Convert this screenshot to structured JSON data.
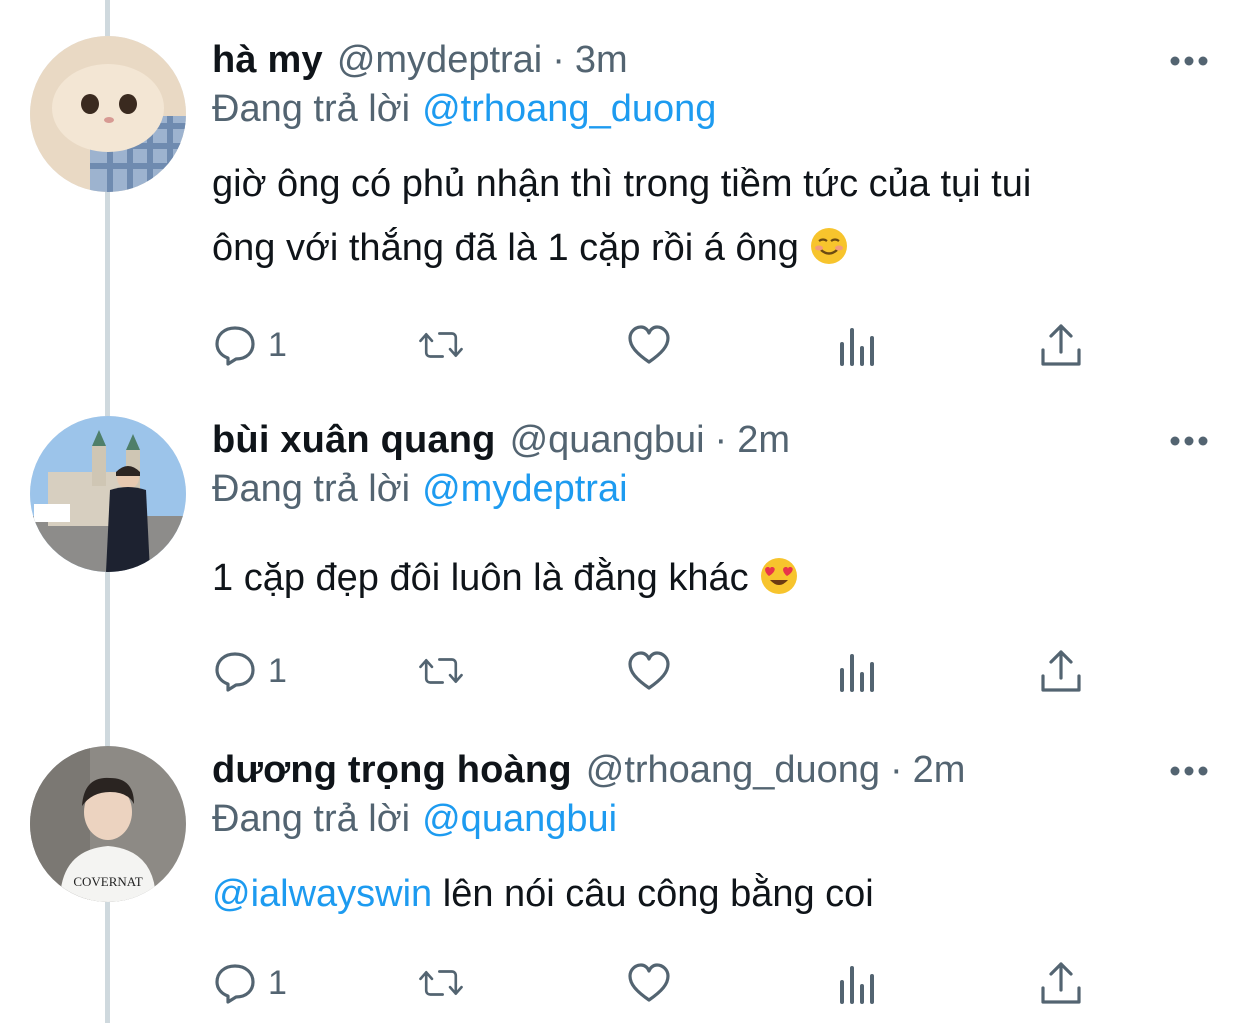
{
  "tweets": [
    {
      "name": "hà my",
      "handle": "@mydeptrai",
      "dot": "·",
      "time": "3m",
      "reply_prefix": "Đang trả lời",
      "reply_to": "@trhoang_duong",
      "text_line1": "giờ ông có phủ nhận thì trong tiềm tức của tụi tui",
      "text_line2": "ông với thắng đã là 1 cặp rồi á ông",
      "emoji": "☺️",
      "reply_count": "1"
    },
    {
      "name": "bùi xuân quang",
      "handle": "@quangbui",
      "dot": "·",
      "time": "2m",
      "reply_prefix": "Đang trả lời",
      "reply_to": "@mydeptrai",
      "text_line1": "1 cặp đẹp đôi luôn là đằng khác",
      "emoji": "😍",
      "reply_count": "1"
    },
    {
      "name": "dương trọng hoàng",
      "handle": "@trhoang_duong",
      "dot": "·",
      "time": "2m",
      "reply_prefix": "Đang trả lời",
      "reply_to": "@quangbui",
      "mention": "@ialwayswin",
      "text_rest": " lên nói câu công bằng coi",
      "reply_count": "1",
      "avatar_shirt_text": "COVERNAT"
    }
  ],
  "icons": [
    "reply-icon",
    "retweet-icon",
    "like-icon",
    "views-icon",
    "share-icon",
    "more-icon"
  ],
  "colors": {
    "link": "#1d9bf0",
    "secondary": "#536471",
    "thread_line": "#cfd9de",
    "text": "#0f1419"
  }
}
